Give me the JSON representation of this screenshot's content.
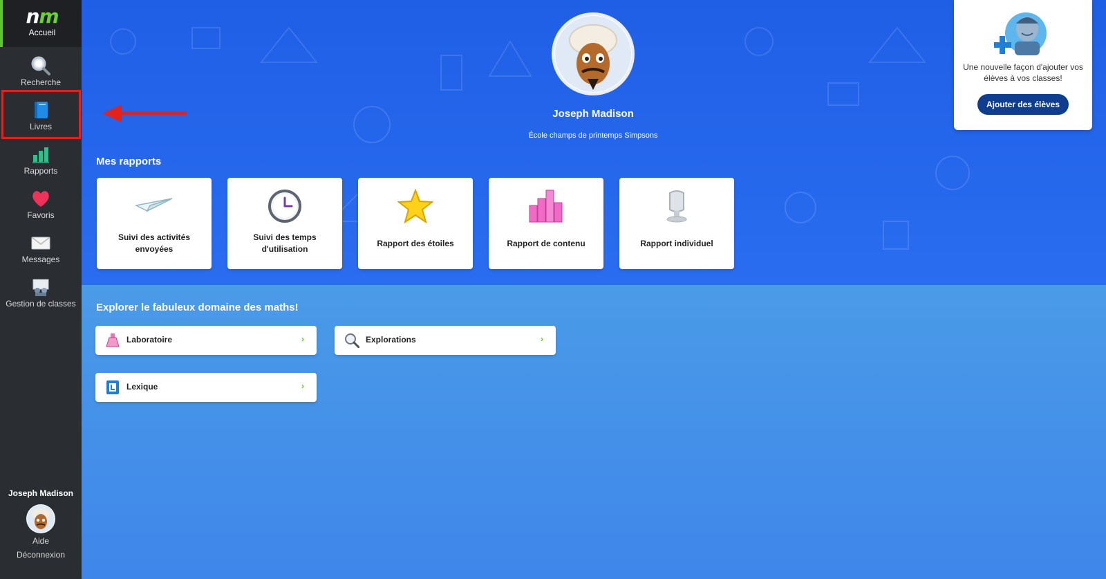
{
  "sidebar": {
    "logo": {
      "text_n": "n",
      "text_m": "m",
      "label": "Accueil"
    },
    "items": [
      {
        "label": "Recherche",
        "icon": "magnifier-icon"
      },
      {
        "label": "Livres",
        "icon": "book-icon"
      },
      {
        "label": "Rapports",
        "icon": "bar-chart-icon"
      },
      {
        "label": "Favoris",
        "icon": "heart-icon"
      },
      {
        "label": "Messages",
        "icon": "envelope-icon"
      },
      {
        "label": "Gestion de classes",
        "icon": "class-management-icon"
      }
    ],
    "user_name": "Joseph Madison",
    "help": "Aide",
    "logout": "Déconnexion"
  },
  "profile": {
    "name": "Joseph Madison",
    "school": "École champs de printemps Simpsons"
  },
  "reports": {
    "title": "Mes rapports",
    "cards": [
      {
        "label": "Suivi des activités envoyées",
        "icon": "paper-plane-icon"
      },
      {
        "label": "Suivi des temps d'utilisation",
        "icon": "clock-icon"
      },
      {
        "label": "Rapport des étoiles",
        "icon": "star-icon"
      },
      {
        "label": "Rapport de contenu",
        "icon": "bar-chart-icon"
      },
      {
        "label": "Rapport individuel",
        "icon": "person-bust-icon"
      }
    ]
  },
  "explore": {
    "title": "Explorer le fabuleux domaine des maths!",
    "cards": [
      {
        "label": "Laboratoire",
        "icon": "flask-icon"
      },
      {
        "label": "Explorations",
        "icon": "magnifier-icon"
      },
      {
        "label": "Lexique",
        "icon": "lexicon-book-icon"
      }
    ],
    "chevron": "›"
  },
  "promo": {
    "text": "Une nouvelle façon d'ajouter vos élèves à vos classes!",
    "button": "Ajouter des élèves"
  },
  "colors": {
    "sidebar": "#2a2d31",
    "hero": "#1f5fe6",
    "accent_green": "#5fc52e",
    "highlight_red": "#e3221b",
    "promo_button": "#0f3e8f"
  }
}
